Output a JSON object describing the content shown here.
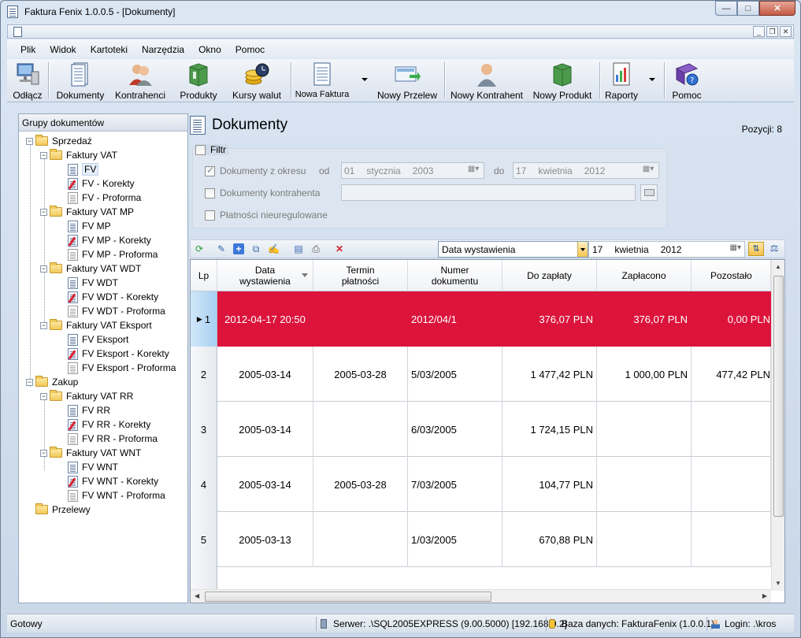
{
  "window": {
    "title": "Faktura Fenix 1.0.0.5 - [Dokumenty]"
  },
  "menu": [
    "Plik",
    "Widok",
    "Kartoteki",
    "Narzędzia",
    "Okno",
    "Pomoc"
  ],
  "toolbar": {
    "odlacz": "Odłącz",
    "dokumenty": "Dokumenty",
    "kontrahenci": "Kontrahenci",
    "produkty": "Produkty",
    "kursy": "Kursy walut",
    "nowa_faktura": "Nowa Faktura",
    "nowy_przelew": "Nowy Przelew",
    "nowy_kontrahent": "Nowy Kontrahent",
    "nowy_produkt": "Nowy Produkt",
    "raporty": "Raporty",
    "pomoc": "Pomoc"
  },
  "left": {
    "header": "Grupy dokumentów",
    "tree": {
      "sprzedaz": "Sprzedaż",
      "faktury_vat": "Faktury VAT",
      "fv": "FV",
      "fv_korekty": "FV - Korekty",
      "fv_proforma": "FV - Proforma",
      "faktury_vat_mp": "Faktury VAT MP",
      "fv_mp": "FV MP",
      "fv_mp_korekty": "FV MP - Korekty",
      "fv_mp_proforma": "FV MP - Proforma",
      "faktury_vat_wdt": "Faktury VAT WDT",
      "fv_wdt": "FV WDT",
      "fv_wdt_korekty": "FV WDT - Korekty",
      "fv_wdt_proforma": "FV WDT - Proforma",
      "faktury_vat_eksport": "Faktury VAT Eksport",
      "fv_eksport": "FV Eksport",
      "fv_eksport_korekty": "FV Eksport - Korekty",
      "fv_eksport_proforma": "FV Eksport - Proforma",
      "zakup": "Zakup",
      "faktury_vat_rr": "Faktury VAT RR",
      "fv_rr": "FV RR",
      "fv_rr_korekty": "FV RR - Korekty",
      "fv_rr_proforma": "FV RR - Proforma",
      "faktury_vat_wnt": "Faktury VAT WNT",
      "fv_wnt": "FV WNT",
      "fv_wnt_korekty": "FV WNT - Korekty",
      "fv_wnt_proforma": "FV WNT - Proforma",
      "przelewy": "Przelewy"
    }
  },
  "main": {
    "title": "Dokumenty",
    "pozycji": "Pozycji: 8",
    "filtr": {
      "label": "Filtr",
      "okres_label": "Dokumenty z okresu",
      "od": "od",
      "do": "do",
      "from_day": "01",
      "from_month": "stycznia",
      "from_year": "2003",
      "to_day": "17",
      "to_month": "kwietnia",
      "to_year": "2012",
      "kontrahent_label": "Dokumenty kontrahenta",
      "kontrahent_value": "",
      "platnosci_label": "Płatności nieuregulowane"
    },
    "grid_toolbar": {
      "sort_field": "Data wystawienia",
      "date_day": "17",
      "date_month": "kwietnia",
      "date_year": "2012"
    },
    "columns": [
      "Lp",
      "Data wystawienia",
      "Termin płatności",
      "Numer dokumentu",
      "Do zapłaty",
      "Zapłacono",
      "Pozostało"
    ],
    "rows": [
      {
        "lp": "1",
        "data": "2012-04-17 20:50",
        "termin": "",
        "numer": "2012/04/1",
        "do_zaplaty": "376,07 PLN",
        "zaplacono": "376,07 PLN",
        "pozostalo": "0,00 PLN"
      },
      {
        "lp": "2",
        "data": "2005-03-14",
        "termin": "2005-03-28",
        "numer": "5/03/2005",
        "do_zaplaty": "1 477,42 PLN",
        "zaplacono": "1 000,00 PLN",
        "pozostalo": "477,42 PLN"
      },
      {
        "lp": "3",
        "data": "2005-03-14",
        "termin": "",
        "numer": "6/03/2005",
        "do_zaplaty": "1 724,15 PLN",
        "zaplacono": "",
        "pozostalo": ""
      },
      {
        "lp": "4",
        "data": "2005-03-14",
        "termin": "2005-03-28",
        "numer": "7/03/2005",
        "do_zaplaty": "104,77 PLN",
        "zaplacono": "",
        "pozostalo": ""
      },
      {
        "lp": "5",
        "data": "2005-03-13",
        "termin": "",
        "numer": "1/03/2005",
        "do_zaplaty": "670,88 PLN",
        "zaplacono": "",
        "pozostalo": ""
      }
    ]
  },
  "status": {
    "ready": "Gotowy",
    "server": "Serwer: .\\SQL2005EXPRESS (9.00.5000) [192.168.0.2]",
    "database": "Baza danych: FakturaFenix (1.0.0.1)",
    "login": "Login: .\\kros"
  }
}
